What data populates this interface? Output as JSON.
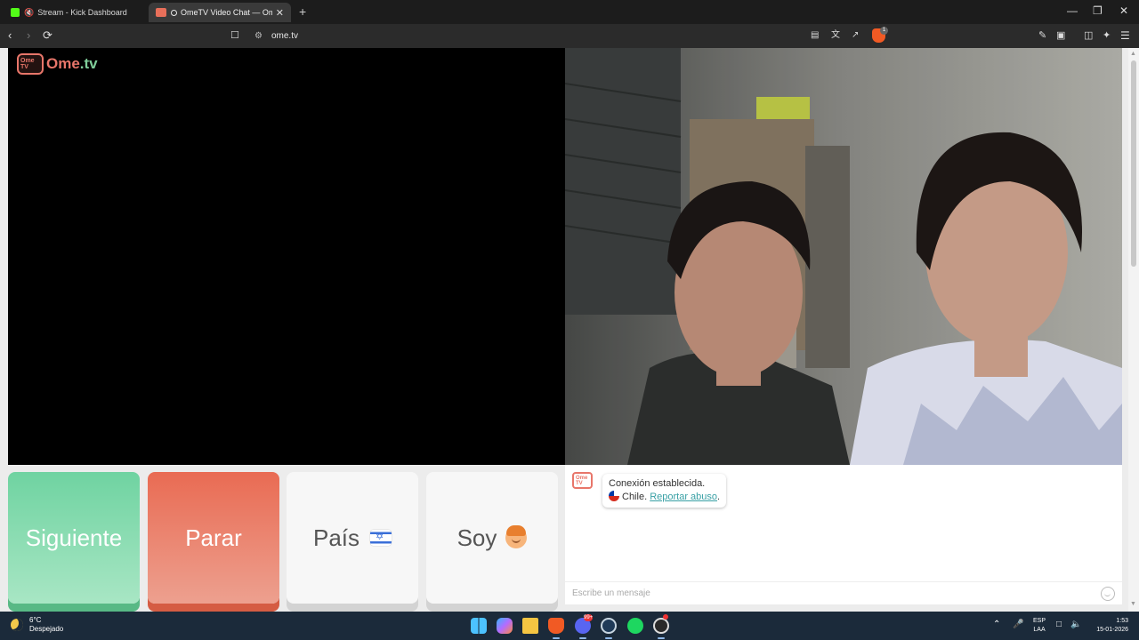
{
  "browser": {
    "tabs": [
      {
        "label": "Stream - Kick Dashboard",
        "active": false
      },
      {
        "label": "OmeTV Video Chat — Omegle",
        "active": true
      }
    ],
    "new_tab": "+",
    "window_controls": {
      "minimize": "—",
      "restore": "❐",
      "close": "✕"
    },
    "address": "ome.tv",
    "brave_badge": "1"
  },
  "site": {
    "logo_tv": "Ome TV",
    "logo_word_ome": "Ome",
    "logo_word_tv": ".tv"
  },
  "buttons": {
    "next": "Siguiente",
    "stop": "Parar",
    "country": "País",
    "gender": "Soy"
  },
  "chat": {
    "avatar_label": "Ome TV",
    "status": "Conexión establecida.",
    "country": "Chile.",
    "report_link": "Reportar abuso",
    "report_suffix": ".",
    "input_placeholder": "Escribe un mensaje"
  },
  "taskbar": {
    "weather_temp": "6°C",
    "weather_desc": "Despejado",
    "discord_badge": "99+",
    "lang_top": "ESP",
    "lang_bottom": "LAA",
    "time": "1:53",
    "date": "15-01-2026"
  },
  "colors": {
    "next": "#6fd3a1",
    "stop": "#e96b53",
    "brand": "#e8766a",
    "link": "#39a0a5"
  }
}
